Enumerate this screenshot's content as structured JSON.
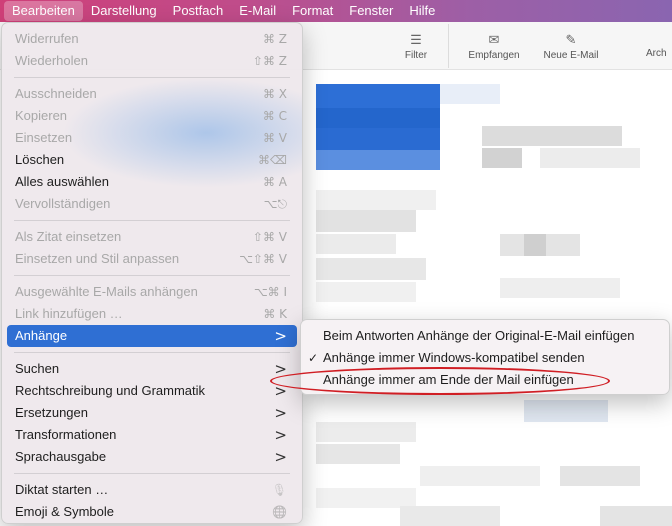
{
  "menubar": {
    "items": [
      "Bearbeiten",
      "Darstellung",
      "Postfach",
      "E-Mail",
      "Format",
      "Fenster",
      "Hilfe"
    ]
  },
  "toolbar": {
    "filter": "Filter",
    "receive": "Empfangen",
    "new_mail": "Neue E-Mail",
    "archive": "Arch"
  },
  "menu": {
    "undo": {
      "label": "Widerrufen",
      "shortcut": "⌘ Z"
    },
    "redo": {
      "label": "Wiederholen",
      "shortcut": "⇧⌘ Z"
    },
    "cut": {
      "label": "Ausschneiden",
      "shortcut": "⌘ X"
    },
    "copy": {
      "label": "Kopieren",
      "shortcut": "⌘ C"
    },
    "paste": {
      "label": "Einsetzen",
      "shortcut": "⌘ V"
    },
    "delete": {
      "label": "Löschen",
      "shortcut": "⌘⌫"
    },
    "select_all": {
      "label": "Alles auswählen",
      "shortcut": "⌘ A"
    },
    "complete": {
      "label": "Vervollständigen",
      "shortcut": "⌥⎋"
    },
    "paste_quote": {
      "label": "Als Zitat einsetzen",
      "shortcut": "⇧⌘ V"
    },
    "paste_match": {
      "label": "Einsetzen und Stil anpassen",
      "shortcut": "⌥⇧⌘ V"
    },
    "attach_selected": {
      "label": "Ausgewählte E-Mails anhängen",
      "shortcut": "⌥⌘ I"
    },
    "add_link": {
      "label": "Link hinzufügen …",
      "shortcut": "⌘ K"
    },
    "attachments": {
      "label": "Anhänge"
    },
    "find": {
      "label": "Suchen"
    },
    "spelling": {
      "label": "Rechtschreibung und Grammatik"
    },
    "substitutions": {
      "label": "Ersetzungen"
    },
    "transformations": {
      "label": "Transformationen"
    },
    "speech": {
      "label": "Sprachausgabe"
    },
    "dictation": {
      "label": "Diktat starten …"
    },
    "emoji": {
      "label": "Emoji & Symbole"
    }
  },
  "submenu": {
    "items": [
      {
        "label": "Beim Antworten Anhänge der Original-E-Mail einfügen",
        "checked": false
      },
      {
        "label": "Anhänge immer Windows-kompatibel senden",
        "checked": true
      },
      {
        "label": "Anhänge immer am Ende der Mail einfügen",
        "checked": false
      }
    ],
    "check_glyph": "✓"
  },
  "icons": {
    "submenu_arrow": ">",
    "mic": "🎙",
    "globe": "🌐"
  },
  "colors": {
    "selection": "#2f6fd3",
    "annotation": "#d01e24"
  }
}
